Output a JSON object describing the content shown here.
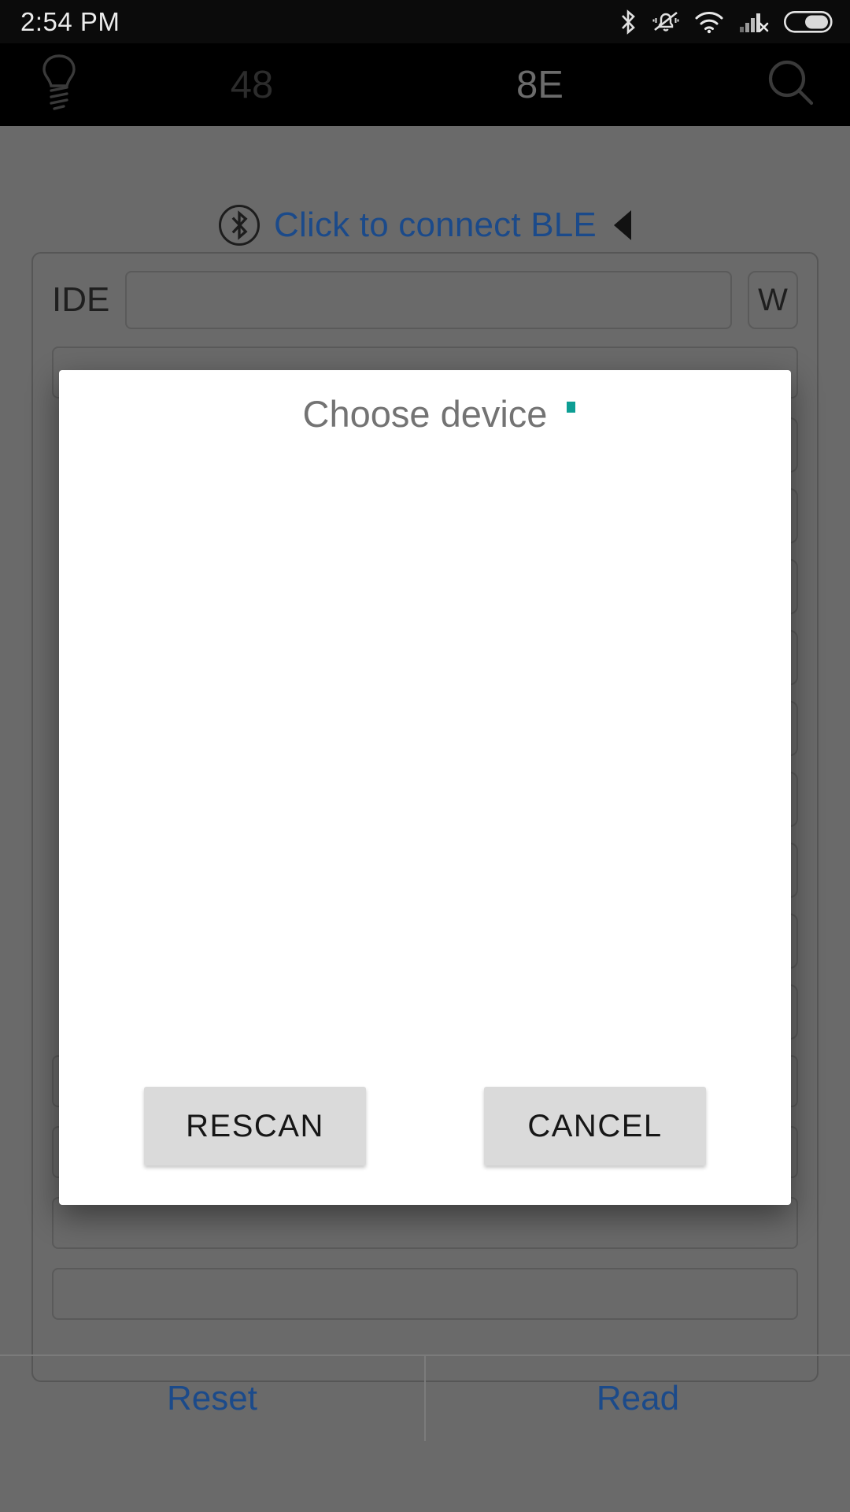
{
  "statusbar": {
    "time": "2:54 PM",
    "icons": [
      {
        "name": "bluetooth-icon"
      },
      {
        "name": "notifications-muted-icon"
      },
      {
        "name": "wifi-icon"
      },
      {
        "name": "cellular-signal-off-icon"
      },
      {
        "name": "battery-icon"
      }
    ]
  },
  "appbar": {
    "left_icon": "lightbulb-icon",
    "right_icon": "search-icon",
    "value_1": "48",
    "value_2": "8E"
  },
  "ble": {
    "icon": "bluetooth-circle-icon",
    "label": "Click to connect BLE",
    "arrow_icon": "triangle-left-icon"
  },
  "form": {
    "ide_label": "IDE",
    "write_button": "W"
  },
  "bottom_bar": {
    "reset_label": "Reset",
    "read_label": "Read"
  },
  "dialog": {
    "title": "Choose device",
    "spinner_color": "#0d9e94",
    "devices": [],
    "rescan_label": "RESCAN",
    "cancel_label": "CANCEL"
  },
  "colors": {
    "link_blue": "#1b4a8a",
    "dim_backdrop": "#6a6a6a",
    "appbar_black": "#000000",
    "dialog_white": "#ffffff",
    "button_grey": "#dadada"
  }
}
